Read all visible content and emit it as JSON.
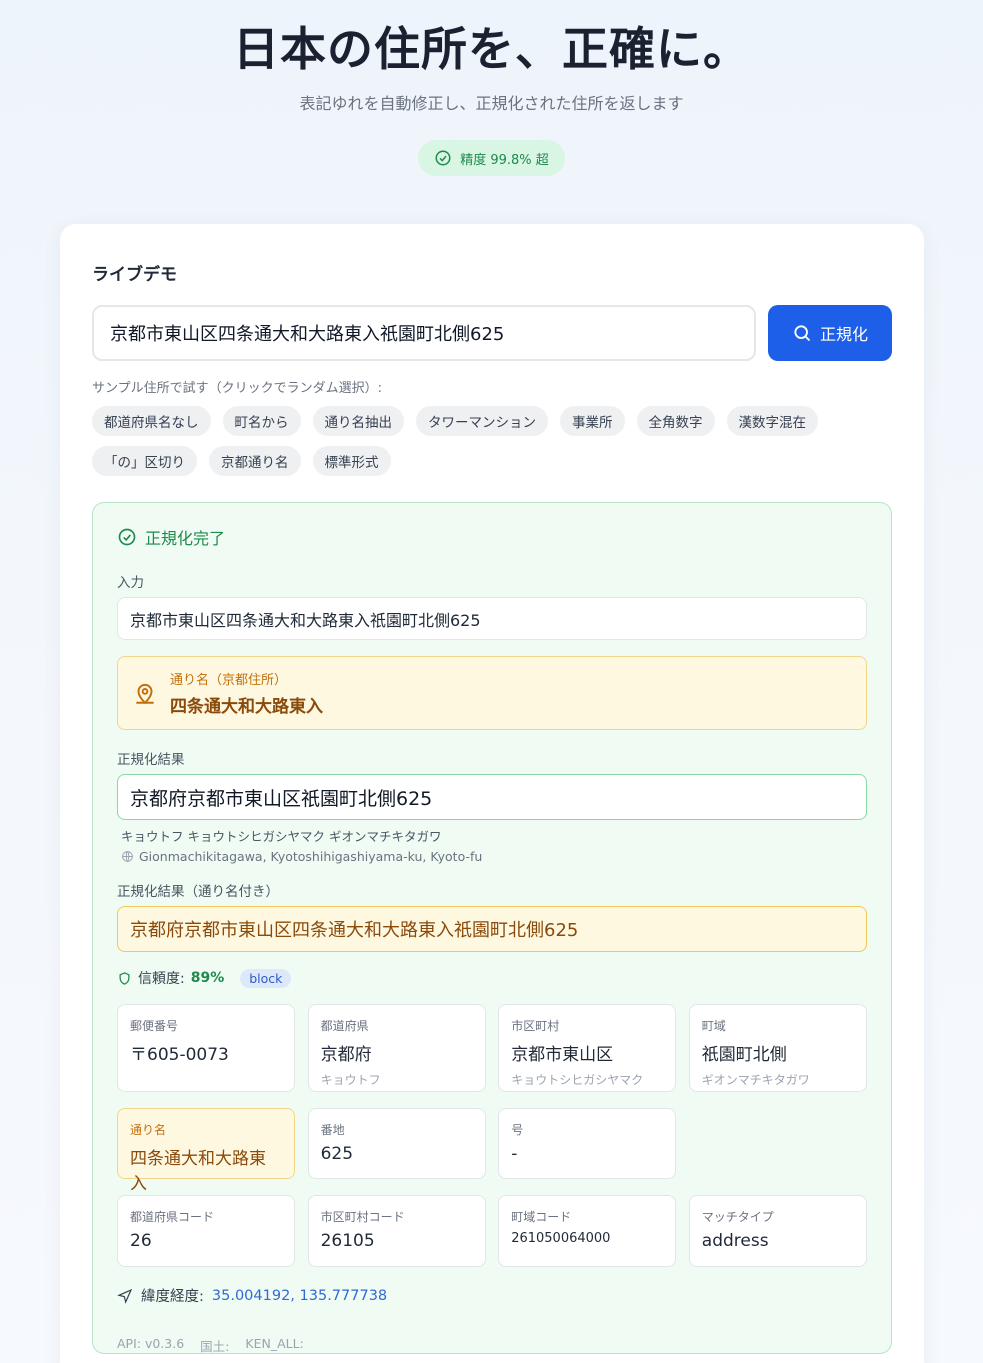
{
  "hero": {
    "title": "日本の住所を、正確に。",
    "subtitle": "表記ゆれを自動修正し、正規化された住所を返します",
    "badge": "精度 99.8% 超"
  },
  "demo": {
    "title": "ライブデモ",
    "input_value": "京都市東山区四条通大和大路東入祇園町北側625",
    "button_label": "正規化",
    "hint": "サンプル住所で試す（クリックでランダム選択）:",
    "chips": [
      "都道府県名なし",
      "町名から",
      "通り名抽出",
      "タワーマンション",
      "事業所",
      "全角数字",
      "漢数字混在",
      "「の」区切り",
      "京都通り名",
      "標準形式"
    ]
  },
  "result": {
    "status": "正規化完了",
    "input_label": "入力",
    "input_value": "京都市東山区四条通大和大路東入祇園町北側625",
    "street_label": "通り名（京都住所）",
    "street_value": "四条通大和大路東入",
    "normalized_label": "正規化結果",
    "normalized_value": "京都府京都市東山区祇園町北側625",
    "kana": "キョウトフ キョウトシヒガシヤマク ギオンマチキタガワ",
    "romaji": "Gionmachikitagawa, Kyotoshihigashiyama-ku, Kyoto-fu",
    "with_street_label": "正規化結果（通り名付き）",
    "with_street_value": "京都府京都市東山区四条通大和大路東入祇園町北側625",
    "confidence_label": "信頼度:",
    "confidence_value": "89%",
    "level_tag": "block",
    "fields": {
      "postal": {
        "label": "郵便番号",
        "value": "〒605-0073"
      },
      "pref": {
        "label": "都道府県",
        "value": "京都府",
        "kana": "キョウトフ"
      },
      "city": {
        "label": "市区町村",
        "value": "京都市東山区",
        "kana": "キョウトシヒガシヤマク"
      },
      "town": {
        "label": "町域",
        "value": "祇園町北側",
        "kana": "ギオンマチキタガワ"
      },
      "street": {
        "label": "通り名",
        "value": "四条通大和大路東入"
      },
      "banchi": {
        "label": "番地",
        "value": "625"
      },
      "go": {
        "label": "号",
        "value": "-"
      },
      "pref_code": {
        "label": "都道府県コード",
        "value": "26"
      },
      "city_code": {
        "label": "市区町村コード",
        "value": "26105"
      },
      "town_code": {
        "label": "町域コード",
        "value": "261050064000"
      },
      "match_type": {
        "label": "マッチタイプ",
        "value": "address"
      }
    },
    "coords_label": "緯度経度:",
    "coords_value": "35.004192, 135.777738",
    "footer": [
      "API: v0.3.6",
      "国土:",
      "KEN_ALL:"
    ]
  },
  "colors": {
    "primary": "#1d5fe8",
    "success": "#1f8a4c",
    "street_accent": "#c2700c"
  }
}
